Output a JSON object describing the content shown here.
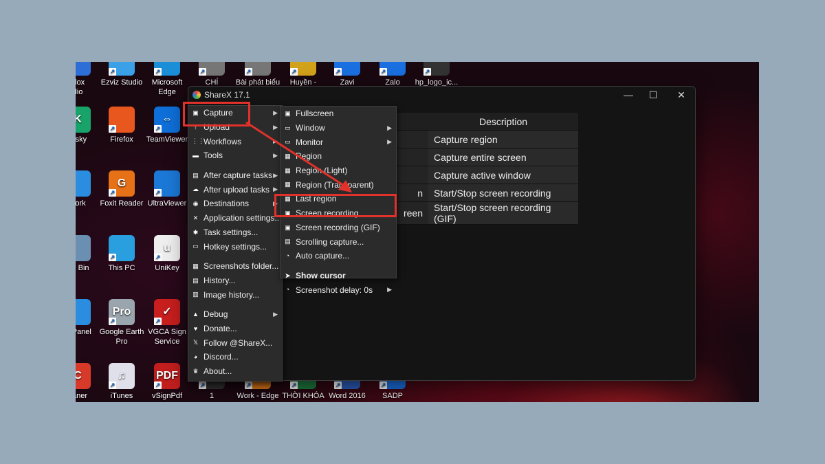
{
  "desktop": {
    "icons": [
      {
        "label": "blox\ndio",
        "color": "#2d6fd6",
        "glyph": ""
      },
      {
        "label": "Ezviz Studio",
        "color": "#3aa0e8",
        "glyph": ""
      },
      {
        "label": "Microsoft\nEdge",
        "color": "#1a8fd8",
        "glyph": ""
      },
      {
        "label": "CHÍ",
        "color": "#777",
        "glyph": ""
      },
      {
        "label": "Bài phát biểu",
        "color": "#777",
        "glyph": ""
      },
      {
        "label": "Huyền -",
        "color": "#d3a21b",
        "glyph": ""
      },
      {
        "label": "Zavi",
        "color": "#1a70e0",
        "glyph": ""
      },
      {
        "label": "Zalo",
        "color": "#1a70e0",
        "glyph": ""
      },
      {
        "label": "hp_logo_ic...",
        "color": "#333",
        "glyph": ""
      },
      {
        "label": "ersky",
        "color": "#18a36a",
        "glyph": "K"
      },
      {
        "label": "Firefox",
        "color": "#e8571e",
        "glyph": ""
      },
      {
        "label": "TeamViewer",
        "color": "#0e6fd8",
        "glyph": "⇔"
      },
      {
        "label": "work",
        "color": "#2a8de0",
        "glyph": ""
      },
      {
        "label": "Foxit Reader",
        "color": "#e67116",
        "glyph": "G"
      },
      {
        "label": "UltraViewer",
        "color": "#1b78d6",
        "glyph": ""
      },
      {
        "label": "cle Bin",
        "color": "#6b8fb0",
        "glyph": ""
      },
      {
        "label": "This PC",
        "color": "#2a9fe0",
        "glyph": ""
      },
      {
        "label": "UniKey",
        "color": "#eee",
        "glyph": "u"
      },
      {
        "label": "ol Panel",
        "color": "#2a8de0",
        "glyph": ""
      },
      {
        "label": "Google Earth\nPro",
        "color": "#9aa5ad",
        "glyph": "Pro"
      },
      {
        "label": "VGCA Sign\nService",
        "color": "#c81e1e",
        "glyph": "✓"
      },
      {
        "label": "eaner",
        "color": "#d83a2a",
        "glyph": "C"
      },
      {
        "label": "iTunes",
        "color": "#e0e0ea",
        "glyph": "♫"
      },
      {
        "label": "vSignPdf",
        "color": "#c21e1e",
        "glyph": "PDF"
      },
      {
        "label": "1",
        "color": "#333",
        "glyph": ""
      },
      {
        "label": "Work - Edge",
        "color": "#e07a1a",
        "glyph": ""
      },
      {
        "label": "THỜI KHÓA",
        "color": "#1d7a3e",
        "glyph": "X"
      },
      {
        "label": "Word 2016",
        "color": "#2b5cb8",
        "glyph": "W"
      },
      {
        "label": "SADP",
        "color": "#1a70e0",
        "glyph": ""
      }
    ]
  },
  "window": {
    "title": "ShareX 17.1",
    "controls": {
      "minimize": "—",
      "maximize": "☐",
      "close": "✕"
    },
    "hotkeys": {
      "header": "Description",
      "rows": [
        {
          "key_fragment": "",
          "description": "Capture region"
        },
        {
          "key_fragment": "",
          "description": "Capture entire screen"
        },
        {
          "key_fragment": "",
          "description": "Capture active window"
        },
        {
          "key_fragment": "n",
          "description": "Start/Stop screen recording"
        },
        {
          "key_fragment": "reen",
          "description": "Start/Stop screen recording (GIF)"
        }
      ]
    }
  },
  "main_menu": {
    "items": [
      {
        "label": "Capture",
        "icon": "capture-icon",
        "glyph": "▣",
        "submenu": true
      },
      {
        "label": "Upload",
        "icon": "upload-icon",
        "glyph": "↑",
        "submenu": true
      },
      {
        "label": "Workflows",
        "icon": "workflows-icon",
        "glyph": "⋮⋮",
        "submenu": true
      },
      {
        "label": "Tools",
        "icon": "tools-icon",
        "glyph": "▬",
        "submenu": true
      },
      {
        "sep": true
      },
      {
        "label": "After capture tasks",
        "icon": "after-capture-icon",
        "glyph": "▤",
        "submenu": true
      },
      {
        "label": "After upload tasks",
        "icon": "after-upload-icon",
        "glyph": "☁",
        "submenu": true
      },
      {
        "label": "Destinations",
        "icon": "destinations-icon",
        "glyph": "◉",
        "submenu": true
      },
      {
        "label": "Application settings...",
        "icon": "settings-icon",
        "glyph": "✕",
        "submenu": false
      },
      {
        "label": "Task settings...",
        "icon": "gear-icon",
        "glyph": "✱",
        "submenu": false
      },
      {
        "label": "Hotkey settings...",
        "icon": "keyboard-icon",
        "glyph": "▭",
        "submenu": false
      },
      {
        "sep": true
      },
      {
        "label": "Screenshots folder...",
        "icon": "folder-icon",
        "glyph": "▦",
        "submenu": false
      },
      {
        "label": "History...",
        "icon": "history-icon",
        "glyph": "▤",
        "submenu": false
      },
      {
        "label": "Image history...",
        "icon": "image-history-icon",
        "glyph": "▥",
        "submenu": false
      },
      {
        "sep": true
      },
      {
        "label": "Debug",
        "icon": "debug-icon",
        "glyph": "▲",
        "submenu": true
      },
      {
        "label": "Donate...",
        "icon": "heart-icon",
        "glyph": "♥",
        "submenu": false
      },
      {
        "label": "Follow @ShareX...",
        "icon": "x-logo-icon",
        "glyph": "𝕏",
        "submenu": false
      },
      {
        "label": "Discord...",
        "icon": "discord-icon",
        "glyph": "◕",
        "submenu": false
      },
      {
        "label": "About...",
        "icon": "crown-icon",
        "glyph": "♛",
        "submenu": false
      }
    ]
  },
  "capture_menu": {
    "items": [
      {
        "label": "Fullscreen",
        "icon": "fullscreen-icon",
        "glyph": "▣",
        "submenu": false
      },
      {
        "label": "Window",
        "icon": "window-icon",
        "glyph": "▭",
        "submenu": true
      },
      {
        "label": "Monitor",
        "icon": "monitor-icon",
        "glyph": "▭",
        "submenu": true
      },
      {
        "label": "Region",
        "icon": "region-icon",
        "glyph": "▦",
        "submenu": false
      },
      {
        "label": "Region (Light)",
        "icon": "region-light-icon",
        "glyph": "▦",
        "submenu": false
      },
      {
        "label": "Region (Transparent)",
        "icon": "region-transparent-icon",
        "glyph": "▦",
        "submenu": false
      },
      {
        "label": "Last region",
        "icon": "last-region-icon",
        "glyph": "▦",
        "submenu": false
      },
      {
        "label": "Screen recording",
        "icon": "screen-recording-icon",
        "glyph": "▣",
        "submenu": false
      },
      {
        "label": "Screen recording (GIF)",
        "icon": "gif-recording-icon",
        "glyph": "▣",
        "submenu": false
      },
      {
        "label": "Scrolling capture...",
        "icon": "scrolling-capture-icon",
        "glyph": "▤",
        "submenu": false
      },
      {
        "label": "Auto capture...",
        "icon": "clock-icon",
        "glyph": "◔",
        "submenu": false
      },
      {
        "sep": true
      },
      {
        "label": "Show cursor",
        "icon": "cursor-icon",
        "glyph": "➤",
        "submenu": false,
        "bold": true
      },
      {
        "label": "Screenshot delay: 0s",
        "icon": "timer-icon",
        "glyph": "◔",
        "submenu": true
      }
    ]
  },
  "colors": {
    "highlight": "#e0322b",
    "menu_bg": "#2b2b2b"
  }
}
